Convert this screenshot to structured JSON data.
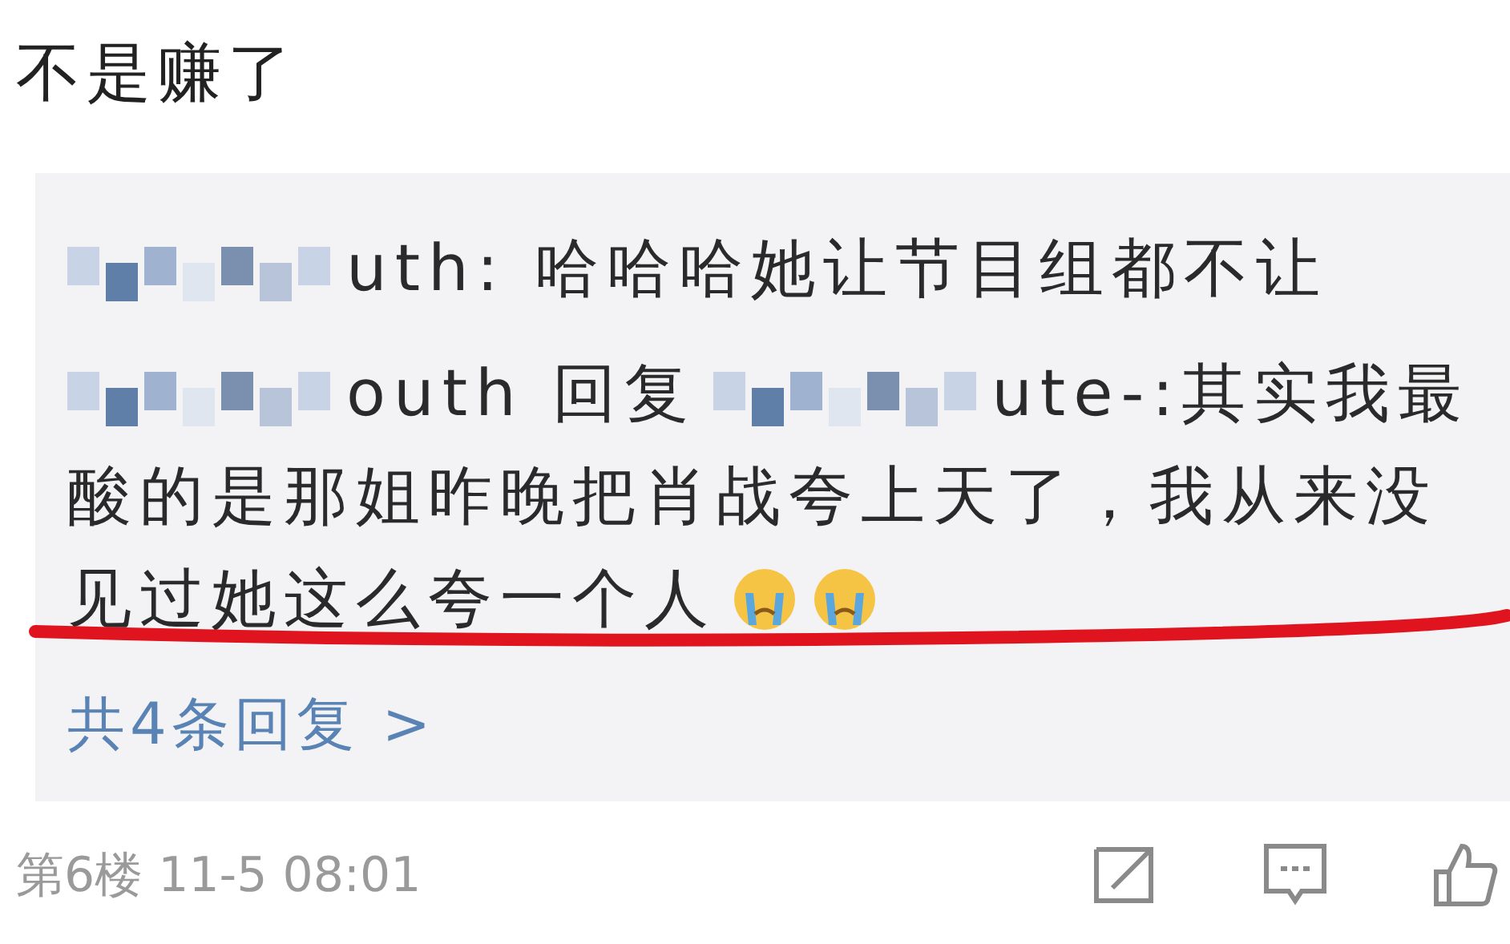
{
  "post": {
    "text": "不是赚了"
  },
  "replies": [
    {
      "lines": [
        [
          {
            "kind": "mosaic"
          },
          {
            "kind": "text",
            "text": "uth: 哈哈哈她让节目组都不让"
          }
        ]
      ]
    },
    {
      "lines": [
        [
          {
            "kind": "mosaic"
          },
          {
            "kind": "text",
            "text": "outh 回复"
          },
          {
            "kind": "mosaic"
          },
          {
            "kind": "text",
            "text": "ute-:其实我最"
          }
        ],
        [
          {
            "kind": "text",
            "text": "酸的是那姐昨晚把肖战夸上天了，我从来没"
          }
        ],
        [
          {
            "kind": "text",
            "text": "见过她这么夸一个人"
          },
          {
            "kind": "emoji"
          },
          {
            "kind": "emoji"
          }
        ]
      ]
    }
  ],
  "more_replies": "共4条回复 >",
  "footer": {
    "meta": "第6楼 11-5 08:01",
    "actions": [
      {
        "kind": "edit"
      },
      {
        "kind": "comment"
      },
      {
        "kind": "like"
      }
    ]
  }
}
